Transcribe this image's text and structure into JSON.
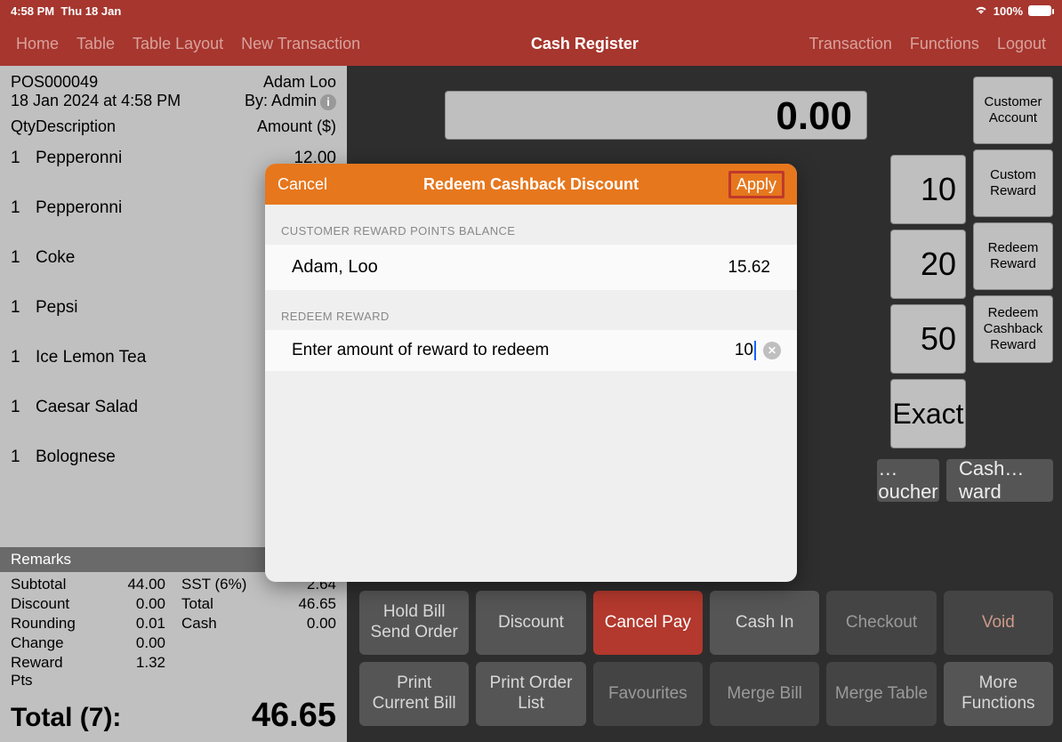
{
  "status": {
    "time": "4:58 PM",
    "date": "Thu 18 Jan",
    "battery": "100%"
  },
  "nav": {
    "left": [
      "Home",
      "Table",
      "Table Layout",
      "New Transaction"
    ],
    "title": "Cash Register",
    "right": [
      "Transaction",
      "Functions",
      "Logout"
    ]
  },
  "receipt": {
    "id": "POS000049",
    "customer": "Adam Loo",
    "datetime": "18 Jan 2024 at 4:58 PM",
    "by_label": "By: Admin",
    "col_qty": "Qty",
    "col_desc": "Description",
    "col_amt": "Amount ($)",
    "items": [
      {
        "qty": "1",
        "desc": "Pepperonni",
        "amt": "12.00"
      },
      {
        "qty": "1",
        "desc": "Pepperonni",
        "amt": ""
      },
      {
        "qty": "1",
        "desc": "Coke",
        "amt": ""
      },
      {
        "qty": "1",
        "desc": "Pepsi",
        "amt": ""
      },
      {
        "qty": "1",
        "desc": "Ice Lemon Tea",
        "amt": ""
      },
      {
        "qty": "1",
        "desc": "Caesar Salad",
        "amt": ""
      },
      {
        "qty": "1",
        "desc": "Bolognese",
        "amt": ""
      }
    ],
    "remarks_label": "Remarks",
    "totals": {
      "subtotal_l": "Subtotal",
      "subtotal_v": "44.00",
      "sst_l": "SST (6%)",
      "sst_v": "2.64",
      "discount_l": "Discount",
      "discount_v": "0.00",
      "total_l": "Total",
      "total_v": "46.65",
      "rounding_l": "Rounding",
      "rounding_v": "0.01",
      "cash_l": "Cash",
      "cash_v": "0.00",
      "change_l": "Change",
      "change_v": "0.00",
      "reward_l": "Reward Pts",
      "reward_v": "1.32"
    },
    "grand_label": "Total (7):",
    "grand_value": "46.65"
  },
  "tender": {
    "display": "0.00",
    "quick": [
      "10",
      "20",
      "50",
      "Exact"
    ],
    "side": [
      "Customer Account",
      "Custom Reward",
      "Redeem Reward",
      "Redeem Cashback Reward"
    ],
    "tags": [
      "…oucher",
      "Cash…ward"
    ]
  },
  "actions": {
    "row1": [
      "Hold Bill\nSend Order",
      "Discount",
      "Cancel Pay",
      "Cash In",
      "Checkout",
      "Void"
    ],
    "row2": [
      "Print\nCurrent Bill",
      "Print Order\nList",
      "Favourites",
      "Merge Bill",
      "Merge Table",
      "More\nFunctions"
    ]
  },
  "modal": {
    "cancel": "Cancel",
    "title": "Redeem Cashback Discount",
    "apply": "Apply",
    "section1": "CUSTOMER REWARD POINTS BALANCE",
    "customer_name": "Adam, Loo",
    "balance": "15.62",
    "section2": "REDEEM REWARD",
    "placeholder": "Enter amount of reward to redeem",
    "input_value": "10"
  }
}
